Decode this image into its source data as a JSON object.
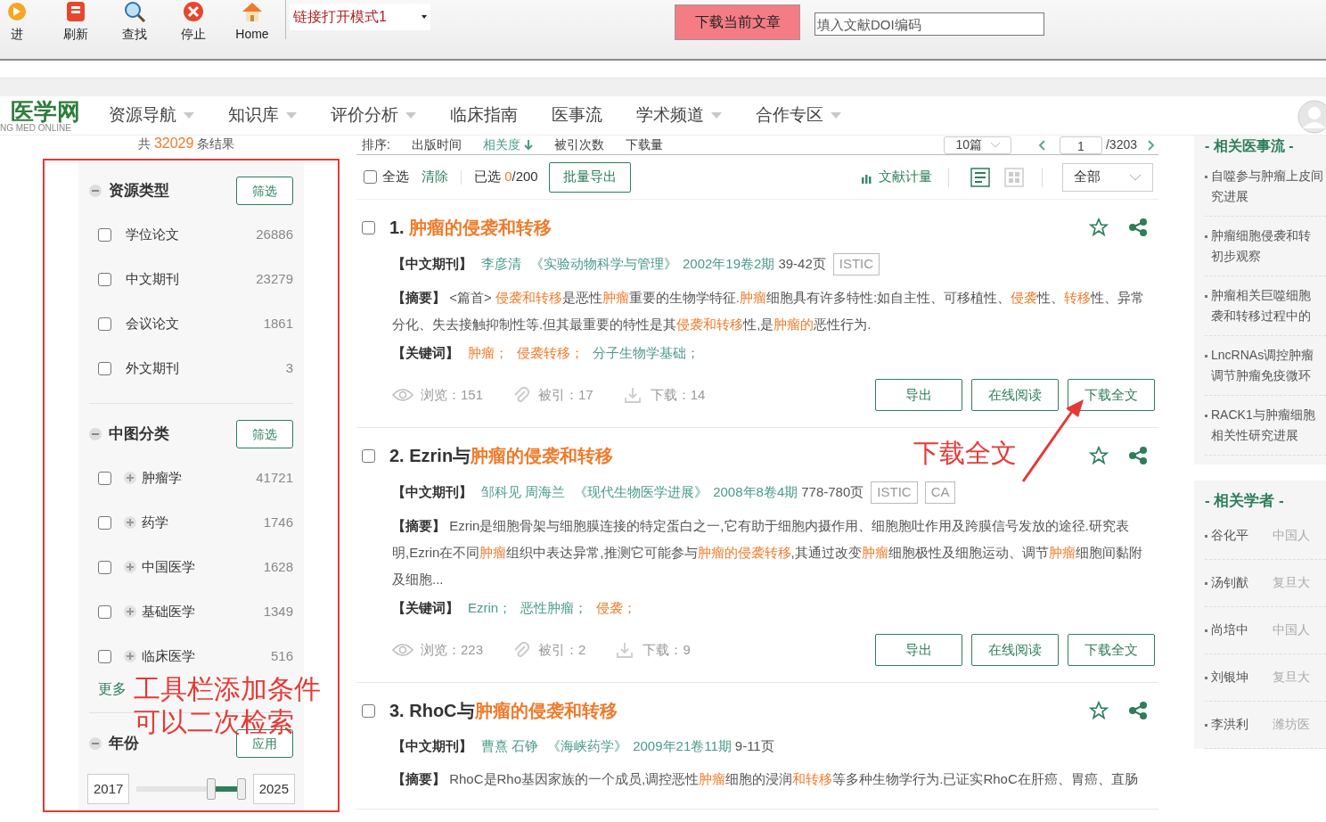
{
  "toolbar": {
    "buttons": [
      {
        "label": "进",
        "kind": "forward"
      },
      {
        "label": "刷新",
        "kind": "refresh"
      },
      {
        "label": "查找",
        "kind": "find"
      },
      {
        "label": "停止",
        "kind": "stop"
      },
      {
        "label": "Home",
        "kind": "home"
      }
    ],
    "mode_select": "链接打开模式1",
    "download_button": "下载当前文章",
    "doi_field": {
      "placeholder": "填入文献DOI编码"
    }
  },
  "nav": {
    "logo": "医学网",
    "logo_sub": "NG MED ONLINE",
    "items": [
      {
        "label": "资源导航",
        "dropdown": true
      },
      {
        "label": "知识库",
        "dropdown": true
      },
      {
        "label": "评价分析",
        "dropdown": true
      },
      {
        "label": "临床指南",
        "dropdown": false
      },
      {
        "label": "医事流",
        "dropdown": false
      },
      {
        "label": "学术频道",
        "dropdown": true
      },
      {
        "label": "合作专区",
        "dropdown": true
      }
    ]
  },
  "result_count": {
    "prefix": "共",
    "count": "32029",
    "suffix": "条结果"
  },
  "sort": {
    "label": "排序:",
    "options": [
      {
        "label": "出版时间",
        "selected": false
      },
      {
        "label": "相关度",
        "selected": true
      },
      {
        "label": "被引次数",
        "selected": false
      },
      {
        "label": "下载量",
        "selected": false
      }
    ],
    "per_page": "10篇",
    "page": "1",
    "pages": "/3203"
  },
  "sidebar": {
    "sections": [
      {
        "title": "资源类型",
        "button": "筛选",
        "items": [
          {
            "label": "学位论文",
            "count": "26886",
            "checked": false,
            "expandable": false
          },
          {
            "label": "中文期刊",
            "count": "23279",
            "checked": false,
            "expandable": false
          },
          {
            "label": "会议论文",
            "count": "1861",
            "checked": false,
            "expandable": false
          },
          {
            "label": "外文期刊",
            "count": "3",
            "checked": false,
            "expandable": false
          }
        ]
      },
      {
        "title": "中图分类",
        "button": "筛选",
        "items": [
          {
            "label": "肿瘤学",
            "count": "41721",
            "checked": false,
            "expandable": true
          },
          {
            "label": "药学",
            "count": "1746",
            "checked": false,
            "expandable": true
          },
          {
            "label": "中国医学",
            "count": "1628",
            "checked": false,
            "expandable": true
          },
          {
            "label": "基础医学",
            "count": "1349",
            "checked": false,
            "expandable": true
          },
          {
            "label": "临床医学",
            "count": "516",
            "checked": false,
            "expandable": true
          }
        ],
        "more": "更多"
      }
    ],
    "year": {
      "title": "年份",
      "button": "应用",
      "from": "2017",
      "to": "2025",
      "low": {
        "level": 0.68
      },
      "high": {
        "level": 1
      }
    }
  },
  "actions": {
    "select_all": {
      "label": "全选",
      "checked": false
    },
    "clear": "清除",
    "selected": {
      "label": "已选",
      "count": "0",
      "limit": "/200"
    },
    "export_button": "批量导出",
    "metrics": "文献计量",
    "views": [
      {
        "kind": "list",
        "selected": true
      },
      {
        "kind": "grid",
        "selected": false
      }
    ],
    "filter": "全部"
  },
  "results": [
    {
      "checked": false,
      "starred": false,
      "title": [
        {
          "text": "1. ",
          "highlight": false
        },
        {
          "text": "肿瘤的侵袭和转移",
          "highlight": true
        }
      ],
      "type": "【中文期刊】",
      "authors": "李彦清",
      "journal": "《实验动物科学与管理》",
      "issue": "2002年19卷2期",
      "pages": "39-42页",
      "tags": [
        "ISTIC"
      ],
      "abstract_label": "【摘要】",
      "abstract": [
        {
          "text": "<篇首> ",
          "highlight": false
        },
        {
          "text": "侵袭和转移",
          "highlight": true
        },
        {
          "text": "是恶性",
          "highlight": false
        },
        {
          "text": "肿瘤",
          "highlight": true
        },
        {
          "text": "重要的生物学特征.",
          "highlight": false
        },
        {
          "text": "肿瘤",
          "highlight": true
        },
        {
          "text": "细胞具有许多特性:如自主性、可移植性、",
          "highlight": false
        },
        {
          "text": "侵袭",
          "highlight": true
        },
        {
          "text": "性、",
          "highlight": false
        },
        {
          "text": "转移",
          "highlight": true
        },
        {
          "text": "性、异常分化、失去接触抑制性等.但其最重要的特性是其",
          "highlight": false
        },
        {
          "text": "侵袭和转移",
          "highlight": true
        },
        {
          "text": "性,是",
          "highlight": false
        },
        {
          "text": "肿瘤的",
          "highlight": true
        },
        {
          "text": "恶性行为.",
          "highlight": false
        }
      ],
      "keywords_label": "【关键词】",
      "keywords": [
        {
          "text": "肿瘤；",
          "highlight": true
        },
        {
          "text": "侵袭转移；",
          "highlight": true
        },
        {
          "text": "分子生物学基础；",
          "highlight": false
        }
      ],
      "views": "浏览：151",
      "cited": "被引：17",
      "downloads": "下载：14",
      "buttons": [
        "导出",
        "在线阅读",
        "下载全文"
      ]
    },
    {
      "checked": false,
      "starred": false,
      "title": [
        {
          "text": "2. Ezrin与",
          "highlight": false
        },
        {
          "text": "肿瘤的侵袭和转移",
          "highlight": true
        }
      ],
      "type": "【中文期刊】",
      "authors": "邹科见 周海兰",
      "journal": "《现代生物医学进展》",
      "issue": "2008年8卷4期",
      "pages": "778-780页",
      "tags": [
        "ISTIC",
        "CA"
      ],
      "abstract_label": "【摘要】",
      "abstract": [
        {
          "text": "Ezrin是细胞骨架与细胞膜连接的特定蛋白之一,它有助于细胞内摄作用、细胞胞吐作用及跨膜信号发放的途径.研究表明,Ezrin在不同",
          "highlight": false
        },
        {
          "text": "肿瘤",
          "highlight": true
        },
        {
          "text": "组织中表达异常,推测它可能参与",
          "highlight": false
        },
        {
          "text": "肿瘤的侵袭转移",
          "highlight": true
        },
        {
          "text": ",其通过改变",
          "highlight": false
        },
        {
          "text": "肿瘤",
          "highlight": true
        },
        {
          "text": "细胞极性及细胞运动、调节",
          "highlight": false
        },
        {
          "text": "肿瘤",
          "highlight": true
        },
        {
          "text": "细胞间黏附及细胞...",
          "highlight": false
        }
      ],
      "keywords_label": "【关键词】",
      "keywords": [
        {
          "text": "Ezrin；",
          "highlight": false
        },
        {
          "text": "恶性肿瘤；",
          "highlight": false
        },
        {
          "text": "侵袭；",
          "highlight": true
        }
      ],
      "views": "浏览：223",
      "cited": "被引：2",
      "downloads": "下载：9",
      "buttons": [
        "导出",
        "在线阅读",
        "下载全文"
      ]
    },
    {
      "checked": false,
      "starred": false,
      "title": [
        {
          "text": "3. RhoC与",
          "highlight": false
        },
        {
          "text": "肿瘤的侵袭和转移",
          "highlight": true
        }
      ],
      "type": "【中文期刊】",
      "authors": "曹熹 石铮",
      "journal": "《海峡药学》",
      "issue": "2009年21卷11期",
      "pages": "9-11页",
      "abstract_label": "【摘要】",
      "abstract": [
        {
          "text": "RhoC是Rho基因家族的一个成员,调控恶性",
          "highlight": false
        },
        {
          "text": "肿瘤",
          "highlight": true
        },
        {
          "text": "细胞的浸润",
          "highlight": false
        },
        {
          "text": "和转移",
          "highlight": true
        },
        {
          "text": "等多种生物学行为.已证实RhoC在肝癌、胃癌、直肠",
          "highlight": false
        }
      ]
    }
  ],
  "related_news": {
    "title": "- 相关医事流 -",
    "items": [
      [
        "自噬参与肿瘤上皮间",
        "究进展"
      ],
      [
        "肿瘤细胞侵袭和转",
        "初步观察"
      ],
      [
        "肿瘤相关巨噬细胞",
        "袭和转移过程中的"
      ],
      [
        "LncRNAs调控肿瘤",
        "调节肿瘤免疫微环"
      ],
      [
        "RACK1与肿瘤细胞",
        "相关性研究进展"
      ]
    ]
  },
  "related_scholars": {
    "title": "- 相关学者 -",
    "items": [
      {
        "name": "谷化平",
        "org": "中国人"
      },
      {
        "name": "汤钊猷",
        "org": "复旦大"
      },
      {
        "name": "尚培中",
        "org": "中国人"
      },
      {
        "name": "刘银坤",
        "org": "复旦大"
      },
      {
        "name": "李洪利",
        "org": "潍坊医"
      }
    ]
  },
  "annotations": [
    {
      "kind": "sidebar",
      "lines": [
        "工具栏添加条件",
        "可以二次检索"
      ]
    },
    {
      "kind": "download",
      "lines": [
        "下载全文"
      ]
    }
  ]
}
